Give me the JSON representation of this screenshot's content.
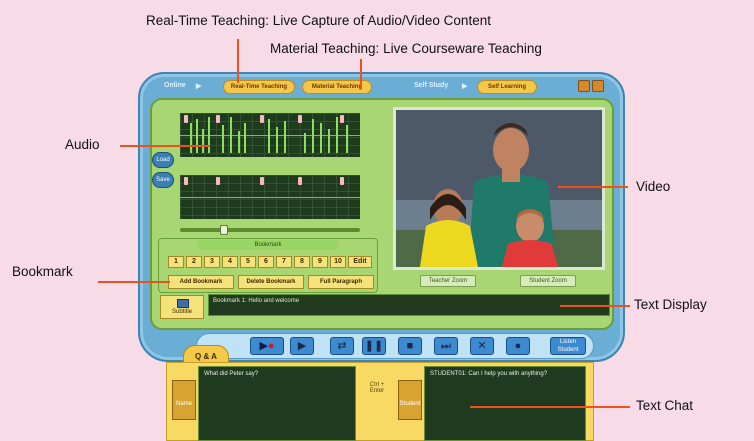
{
  "annotations": {
    "realtime": "Real-Time Teaching: Live Capture of Audio/Video Content",
    "material": "Material Teaching: Live Courseware Teaching",
    "audio": "Audio",
    "video": "Video",
    "bookmark": "Bookmark",
    "text_display": "Text Display",
    "text_chat": "Text Chat"
  },
  "toolbar": {
    "online_label": "Online",
    "realtime_button": "Real-Time Teaching",
    "material_button": "Material Teaching",
    "selfstudy_label": "Self Study",
    "selflearning_button": "Self Learning"
  },
  "side_buttons": {
    "top": "Load",
    "bottom": "Save"
  },
  "video_buttons": {
    "teacher": "Teacher Zoom",
    "student": "Student Zoom"
  },
  "bookmark": {
    "title": "Bookmark",
    "numbers": [
      "1",
      "2",
      "3",
      "4",
      "5",
      "6",
      "7",
      "8",
      "9",
      "10",
      "Edit"
    ],
    "add": "Add Bookmark",
    "delete": "Delete Bookmark",
    "full": "Full Paragraph"
  },
  "text_display": {
    "button": "Subtitle",
    "content": "Bookmark 1: Hello and welcome"
  },
  "controls": {
    "listen_button": "Listen Student"
  },
  "chat": {
    "qa_tab": "Q & A",
    "left_content": "What did Peter say?",
    "left_icon_label": "Name",
    "center_label": "Ctrl + Enter",
    "right_content": "STUDENT01: Can I help you with anything?",
    "right_icon_label": "Student"
  },
  "colors": {
    "background": "#f7dbe6",
    "window": "#6aaed5",
    "panel": "#a8d672",
    "annotation_line": "#f0501e",
    "chat": "#f7d964"
  }
}
